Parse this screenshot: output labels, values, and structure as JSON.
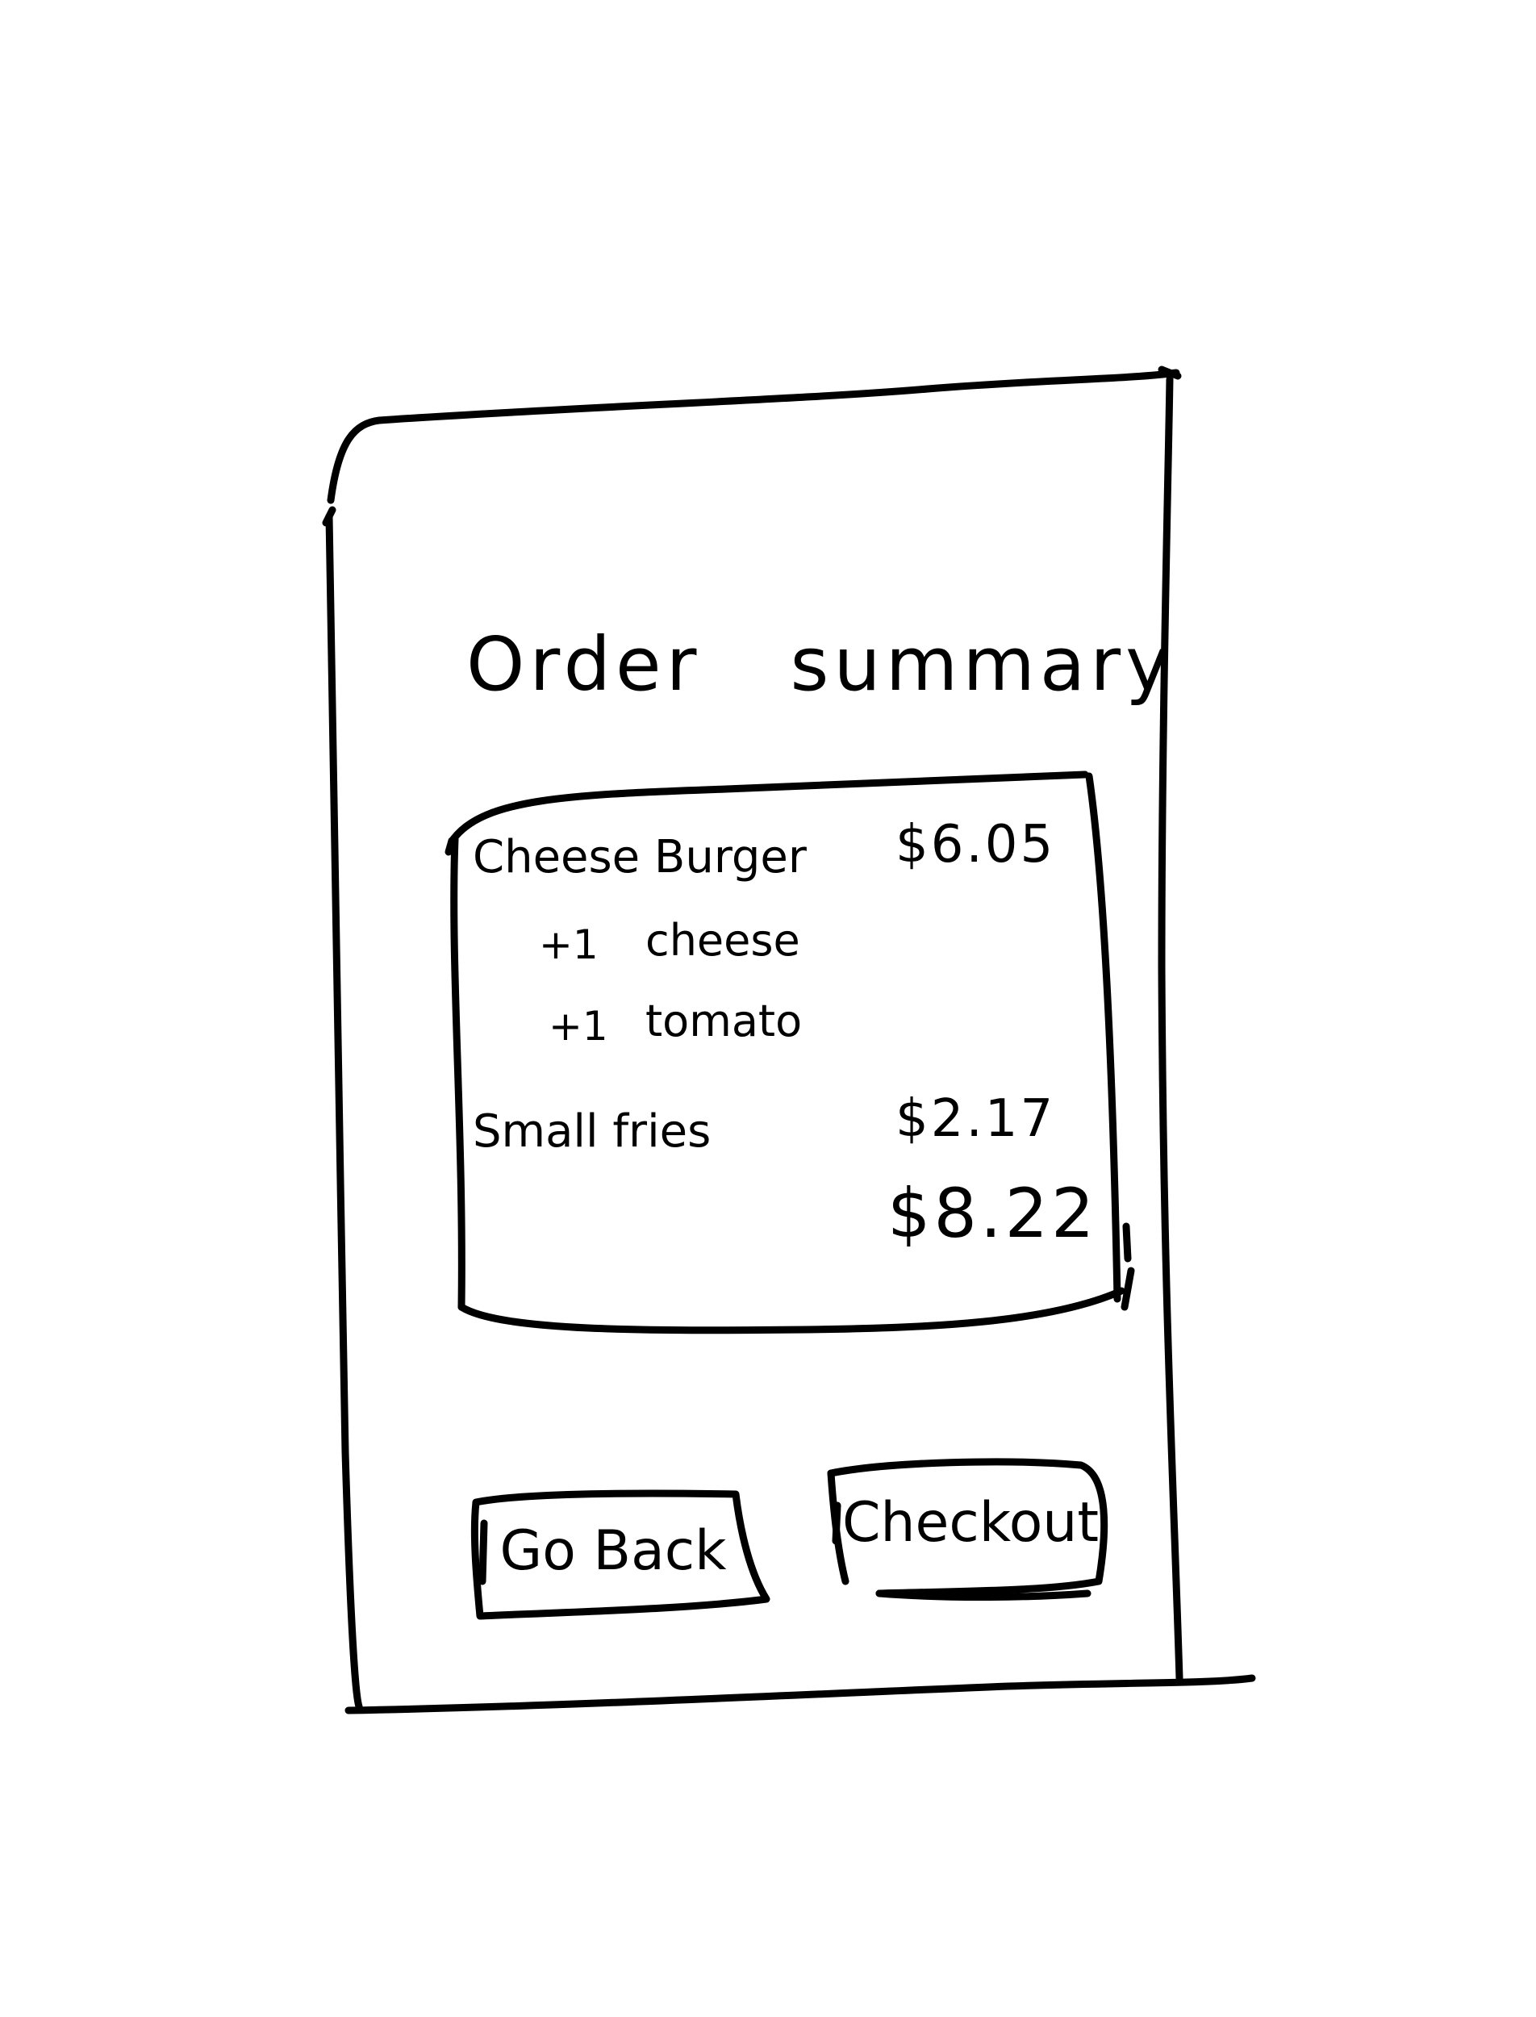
{
  "screen": {
    "title_words": [
      "Order",
      "summary"
    ]
  },
  "order": {
    "items": [
      {
        "name": "Cheese Burger",
        "price": "$6.05",
        "modifiers": [
          {
            "prefix": "+1",
            "name": "cheese"
          },
          {
            "prefix": "+1",
            "name": "tomato"
          }
        ]
      },
      {
        "name": "Small fries",
        "price": "$2.17",
        "modifiers": []
      }
    ],
    "total": "$8.22"
  },
  "actions": {
    "go_back_label": "Go Back",
    "checkout_label": "Checkout"
  },
  "style": {
    "ink": "#000000",
    "paper": "#ffffff"
  }
}
